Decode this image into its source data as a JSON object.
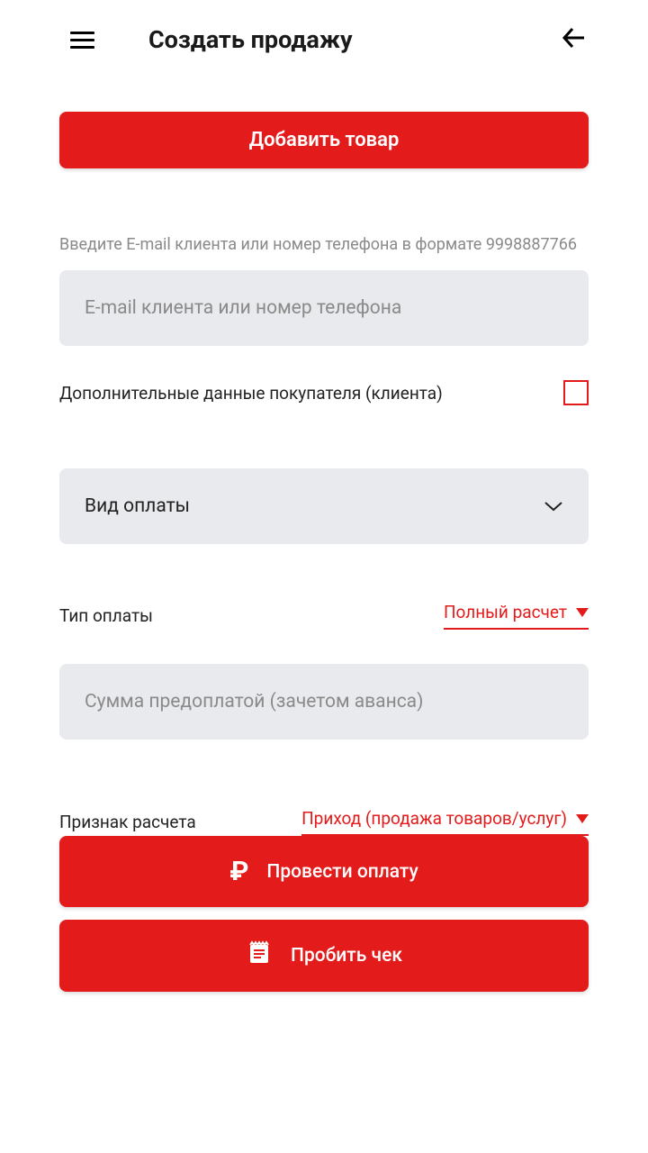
{
  "header": {
    "title": "Создать продажу"
  },
  "add_product_btn": "Добавить товар",
  "email_hint": "Введите E-mail клиента или номер телефона в формате 9998887766",
  "email_placeholder": "E-mail клиента или номер телефона",
  "additional_data_label": "Дополнительные данные покупателя (клиента)",
  "payment_kind_label": "Вид оплаты",
  "payment_type": {
    "label": "Тип оплаты",
    "value": "Полный расчет"
  },
  "prepay_placeholder": "Сумма предоплатой (зачетом аванса)",
  "calc_sign": {
    "label": "Признак расчета",
    "value": "Приход (продажа товаров/услуг)"
  },
  "make_payment_btn": "Провести оплату",
  "print_receipt_btn": "Пробить чек"
}
